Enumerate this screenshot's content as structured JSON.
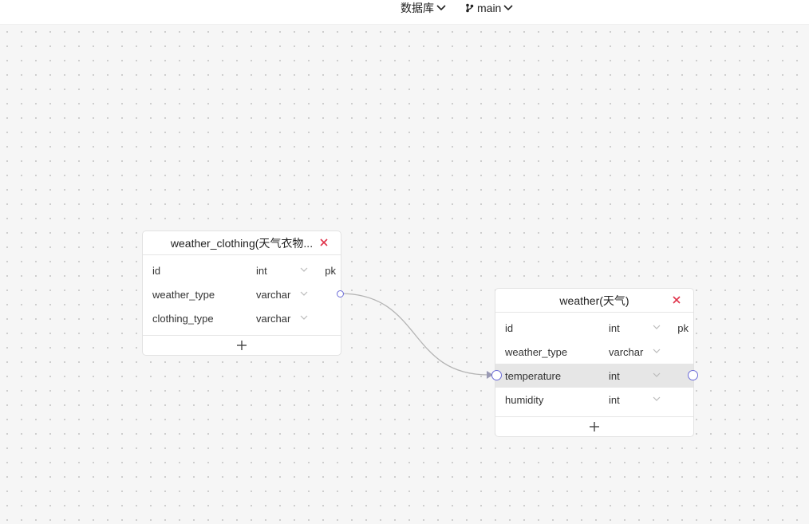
{
  "topbar": {
    "database_label": "数据库",
    "branch_label": "main"
  },
  "tables": [
    {
      "title": "weather_clothing(天气衣物...",
      "fields": [
        {
          "name": "id",
          "type": "int",
          "key": "pk"
        },
        {
          "name": "weather_type",
          "type": "varchar",
          "key": ""
        },
        {
          "name": "clothing_type",
          "type": "varchar",
          "key": ""
        }
      ]
    },
    {
      "title": "weather(天气)",
      "fields": [
        {
          "name": "id",
          "type": "int",
          "key": "pk"
        },
        {
          "name": "weather_type",
          "type": "varchar",
          "key": ""
        },
        {
          "name": "temperature",
          "type": "int",
          "key": ""
        },
        {
          "name": "humidity",
          "type": "int",
          "key": ""
        }
      ]
    }
  ],
  "colors": {
    "port": "#6c6cd8",
    "close": "#e0334a",
    "edge": "#b4b4b4",
    "highlight_row": "#e6e6e6"
  },
  "icons": [
    "chevron-down-icon",
    "git-branch-icon",
    "close-icon",
    "plus-icon"
  ]
}
